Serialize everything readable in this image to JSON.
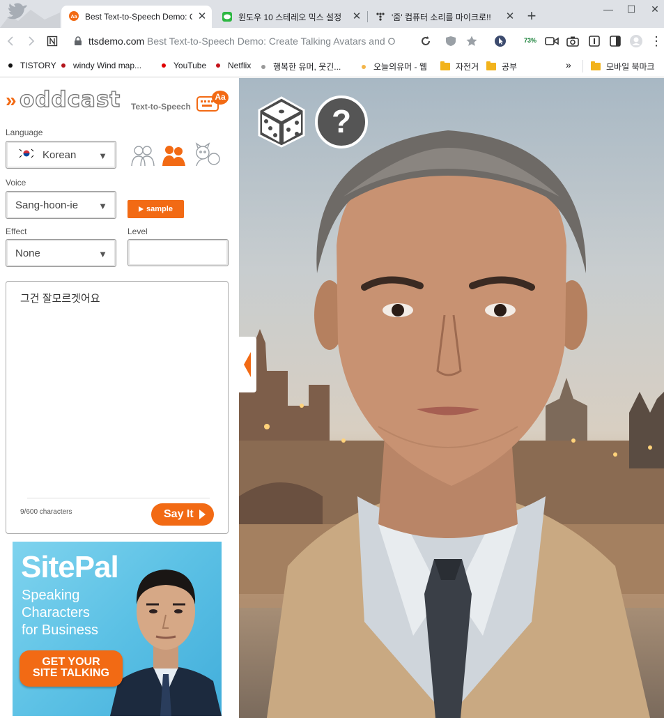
{
  "browser": {
    "tabs": [
      {
        "title": "Best Text-to-Speech Demo: C",
        "active": true
      },
      {
        "title": "윈도우 10 스테레오 믹스 설정",
        "active": false
      },
      {
        "title": "'줌' 컴퓨터 소리를 마이크로!!",
        "active": false
      }
    ],
    "new_tab_symbol": "+",
    "address": {
      "domain": "ttsdemo.com",
      "page_title": "Best Text-to-Speech Demo: Create Talking Avatars and O"
    },
    "zoom_percent": "73%",
    "bookmarks": [
      {
        "label": "TISTORY",
        "dot_color": "#111111",
        "type": "site"
      },
      {
        "label": "windy Wind map...",
        "dot_color": "#b3151b",
        "type": "site"
      },
      {
        "label": "YouTube",
        "dot_color": "#e00000",
        "type": "site"
      },
      {
        "label": "Netflix",
        "dot_color": "#c4121a",
        "type": "site"
      },
      {
        "label": "행복한 유머, 웃긴...",
        "dot_color": "#999999",
        "type": "site"
      },
      {
        "label": "오늘의유머 - 웹",
        "dot_color": "#f3b54a",
        "type": "site"
      },
      {
        "label": "자전거",
        "type": "folder"
      },
      {
        "label": "공부",
        "type": "folder"
      }
    ],
    "bookmarks_overflow": "»",
    "mobile_bookmarks": "모바일 북마크"
  },
  "app": {
    "logo_text": "oddcast",
    "logo_chevrons": "»",
    "subtitle": "Text-to-Speech",
    "badge": "Aa",
    "language": {
      "label": "Language",
      "value": "Korean",
      "flag": "south-korea-flag"
    },
    "voice": {
      "label": "Voice",
      "value": "Sang-hoon-ie"
    },
    "sample_button": "sample",
    "effect": {
      "label": "Effect",
      "value": "None"
    },
    "level": {
      "label": "Level",
      "value": ""
    },
    "text_input": "그건 잘모르겟어요",
    "char_count": "9/600 characters",
    "say_it": "Say It",
    "avatar_modes": [
      "people-group-icon",
      "people-orange-icon",
      "animals-icon"
    ]
  },
  "ad": {
    "brand": "SitePal",
    "lines": [
      "Speaking",
      "Characters",
      "for Business"
    ],
    "cta_line1": "GET YOUR",
    "cta_line2": "SITE TALKING"
  },
  "scene": {
    "controls": [
      "dice-icon",
      "help-icon"
    ],
    "help_symbol": "?"
  }
}
